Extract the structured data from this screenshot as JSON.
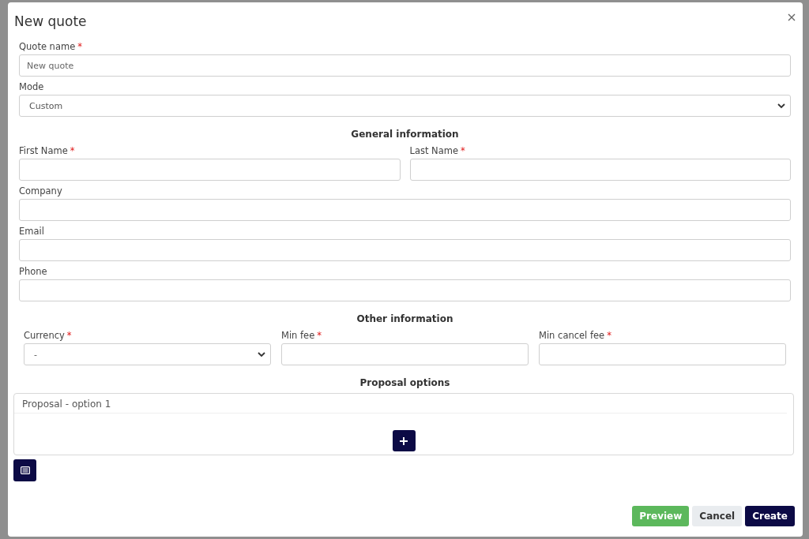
{
  "dialog": {
    "title": "New quote"
  },
  "required_mark": "*",
  "top_fields": [
    {
      "kind": "text",
      "label": "Quote name",
      "required": true,
      "placeholder": "New quote"
    },
    {
      "kind": "select",
      "label": "Mode",
      "required": false,
      "value": "Custom"
    }
  ],
  "general_section": {
    "heading": "General information",
    "rows": [
      [
        {
          "kind": "text",
          "label": "First Name",
          "required": true
        },
        {
          "kind": "text",
          "label": "Last Name",
          "required": true
        }
      ],
      [
        {
          "kind": "text",
          "label": "Company",
          "required": false
        }
      ],
      [
        {
          "kind": "text",
          "label": "Email",
          "required": false
        }
      ],
      [
        {
          "kind": "text",
          "label": "Phone",
          "required": false
        }
      ]
    ]
  },
  "other_section": {
    "heading": "Other information",
    "fields": [
      {
        "kind": "select",
        "label": "Currency",
        "required": true,
        "value": "-"
      },
      {
        "kind": "text",
        "label": "Min fee",
        "required": true
      },
      {
        "kind": "text",
        "label": "Min cancel fee",
        "required": true
      }
    ]
  },
  "proposal_section": {
    "heading": "Proposal options",
    "options": [
      {
        "title": "Proposal - option 1"
      }
    ]
  },
  "buttons": [
    {
      "kind": "success",
      "label": "Preview"
    },
    {
      "kind": "secondary",
      "label": "Cancel"
    },
    {
      "kind": "primary",
      "label": "Create"
    }
  ]
}
